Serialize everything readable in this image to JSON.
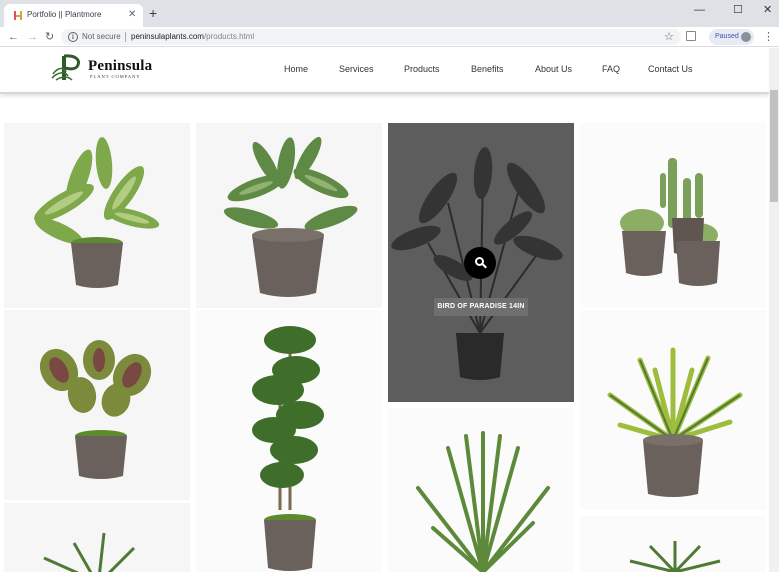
{
  "browser": {
    "tab_title": "Portfolio || Plantmore",
    "tab_close": "✕",
    "new_tab": "+",
    "window_controls": {
      "minimize": "—",
      "maximize": "☐",
      "close": "✕"
    },
    "nav": {
      "back": "←",
      "forward": "→",
      "reload": "↻"
    },
    "security": "Not secure",
    "url_host": "peninsulaplants.com",
    "url_path": "/products.html",
    "star": "☆",
    "profile_status": "Paused",
    "menu": "⋮"
  },
  "site": {
    "logo": {
      "brand": "Peninsula",
      "tagline": "PLANT COMPANY"
    },
    "nav": [
      "Home",
      "Services",
      "Products",
      "Benefits",
      "About Us",
      "FAQ",
      "Contact Us"
    ]
  },
  "products": {
    "hovered_caption": "BIRD OF PARADISE 14IN"
  },
  "colors": {
    "plant_green": "#4f7a35",
    "plant_light": "#a9c46a",
    "pot": "#6b615c",
    "overlay": "#5d5d5d"
  }
}
